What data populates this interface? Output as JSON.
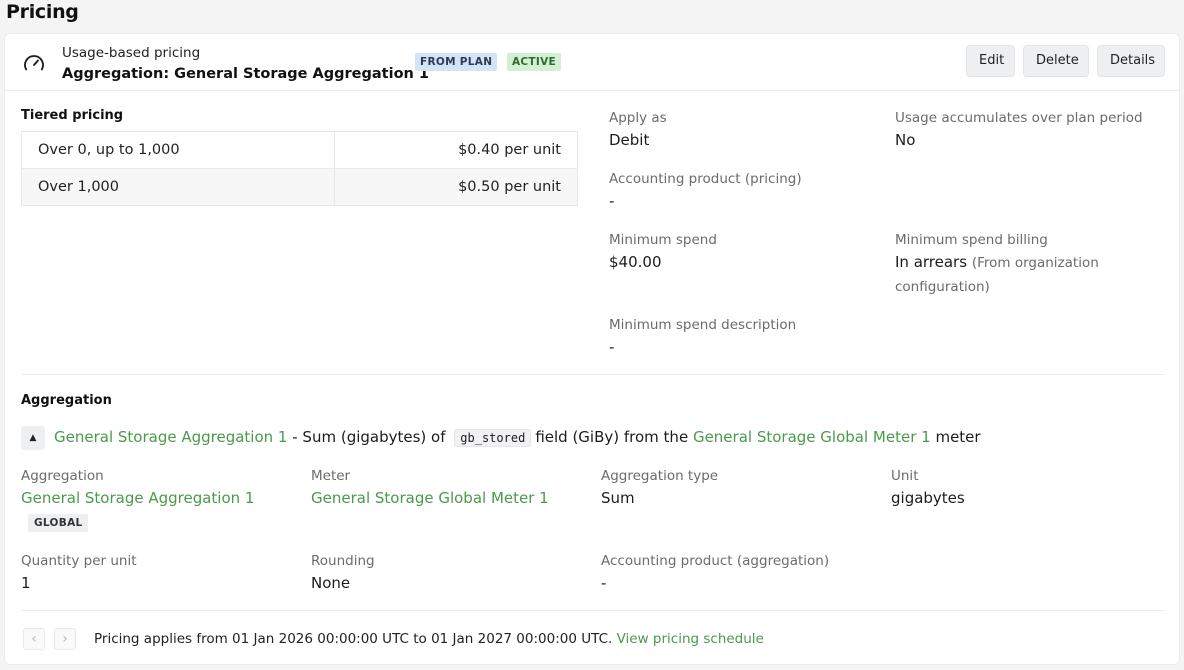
{
  "page": {
    "title": "Pricing"
  },
  "header": {
    "subtitle": "Usage-based pricing",
    "title": "Aggregation: General Storage Aggregation 1",
    "badges": [
      "FROM PLAN",
      "ACTIVE"
    ],
    "buttons": {
      "edit": "Edit",
      "delete": "Delete",
      "details": "Details"
    },
    "icon": "gauge-icon"
  },
  "tiered": {
    "title": "Tiered pricing",
    "rows": [
      {
        "range": "Over 0, up to 1,000",
        "price": "$0.40 per unit"
      },
      {
        "range": "Over 1,000",
        "price": "$0.50 per unit"
      }
    ]
  },
  "details": {
    "apply_as": {
      "label": "Apply as",
      "value": "Debit"
    },
    "usage_accumulates": {
      "label": "Usage accumulates over plan period",
      "value": "No"
    },
    "accounting_product": {
      "label": "Accounting product (pricing)",
      "value": "-"
    },
    "minimum_spend": {
      "label": "Minimum spend",
      "value": "$40.00"
    },
    "minimum_spend_billing": {
      "label": "Minimum spend billing",
      "value": "In arrears",
      "note_line1": "(From organization",
      "note_line2": "configuration)"
    },
    "minimum_spend_description": {
      "label": "Minimum spend description",
      "value": "-"
    }
  },
  "aggregation": {
    "title": "Aggregation",
    "summary": {
      "name": "General Storage Aggregation 1",
      "text1": "- Sum (gigabytes) of",
      "field": "gb_stored",
      "text2": "field (GiBy) from the",
      "meter": "General Storage Global Meter 1",
      "text3": "meter"
    },
    "fields": {
      "aggregation": {
        "label": "Aggregation",
        "value": "General Storage Aggregation 1",
        "badge": "GLOBAL"
      },
      "meter": {
        "label": "Meter",
        "value": "General Storage Global Meter 1"
      },
      "aggregation_type": {
        "label": "Aggregation type",
        "value": "Sum"
      },
      "unit": {
        "label": "Unit",
        "value": "gigabytes"
      },
      "quantity_per_unit": {
        "label": "Quantity per unit",
        "value": "1"
      },
      "rounding": {
        "label": "Rounding",
        "value": "None"
      },
      "accounting_product": {
        "label": "Accounting product (aggregation)",
        "value": "-"
      }
    }
  },
  "footer": {
    "text": "Pricing applies from 01 Jan 2026 00:00:00 UTC to 01 Jan 2027 00:00:00 UTC.",
    "link": "View pricing schedule"
  },
  "colors": {
    "link": "#4a9a4c",
    "badge_plan_bg": "#d4e4f7",
    "badge_active_bg": "#d3efd4"
  }
}
